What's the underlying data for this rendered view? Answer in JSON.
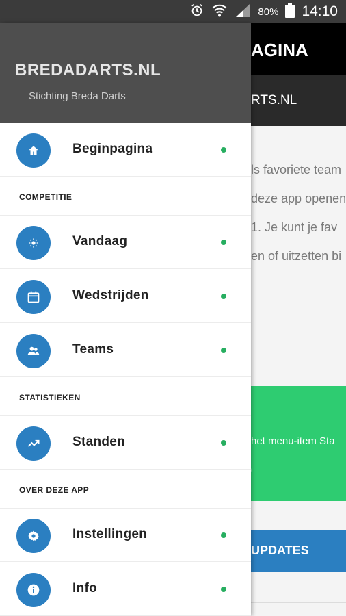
{
  "status_bar": {
    "battery_percent": "80%",
    "time": "14:10",
    "icons": [
      "alarm-icon",
      "wifi-icon",
      "signal-icon",
      "battery-icon"
    ]
  },
  "background_page": {
    "title_fragment": "AGINA",
    "subtitle_fragment": "RTS.NL",
    "text_lines": [
      "ls favoriete team",
      "deze app openen",
      "1. Je kunt je fav",
      "en of uitzetten bi"
    ],
    "green_card_line1": "het menu-item Sta",
    "green_card_line2": ")",
    "blue_button_fragment": "UPDATES"
  },
  "drawer": {
    "brand": "BREDADARTS.NL",
    "tagline": "Stichting Breda Darts",
    "items": [
      {
        "type": "item",
        "label": "Beginpagina",
        "icon": "home-icon"
      },
      {
        "type": "section",
        "label": "COMPETITIE"
      },
      {
        "type": "item",
        "label": "Vandaag",
        "icon": "sun-icon"
      },
      {
        "type": "item",
        "label": "Wedstrijden",
        "icon": "calendar-icon"
      },
      {
        "type": "item",
        "label": "Teams",
        "icon": "people-icon"
      },
      {
        "type": "section",
        "label": "STATISTIEKEN"
      },
      {
        "type": "item",
        "label": "Standen",
        "icon": "trending-up-icon"
      },
      {
        "type": "section",
        "label": "OVER DEZE APP"
      },
      {
        "type": "item",
        "label": "Instellingen",
        "icon": "gear-icon"
      },
      {
        "type": "item",
        "label": "Info",
        "icon": "info-icon"
      }
    ]
  },
  "colors": {
    "accent_blue": "#2b7fc1",
    "dot_green": "#27ae60",
    "card_green": "#2ecc71",
    "header_gray": "#4e4e4e",
    "status_bar": "#3b3b3b"
  }
}
